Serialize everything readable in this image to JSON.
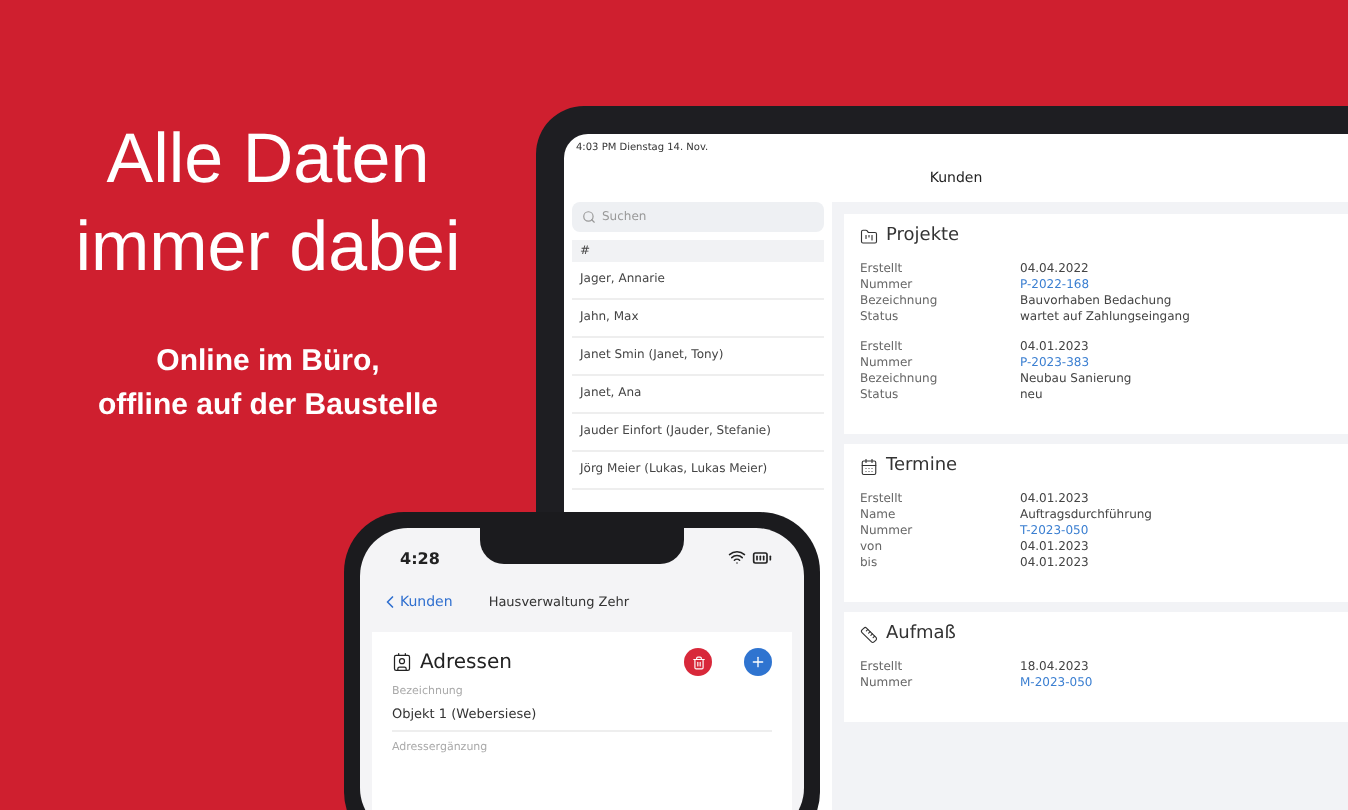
{
  "headline": [
    "Alle Daten",
    "immer dabei"
  ],
  "subline": [
    "Online im Büro,",
    "offline auf der Baustelle"
  ],
  "tablet": {
    "status": "4:03 PM  Dienstag 14. Nov.",
    "title": "Kunden",
    "search": {
      "placeholder": "Suchen"
    },
    "index_letter": "#",
    "customers": [
      {
        "name": "Jager, Annarie"
      },
      {
        "name": "Jahn, Max"
      },
      {
        "name": "Janet Smin (Janet, Tony)"
      },
      {
        "name": "Janet, Ana"
      },
      {
        "name": "Jauder Einfort (Jauder, Stefanie)"
      },
      {
        "name": "Jörg Meier (Lukas, Lukas Meier)"
      }
    ],
    "sections": [
      {
        "kind": "projects",
        "title": "Projekte",
        "groups": [
          [
            {
              "label": "Erstellt",
              "value": "04.04.2022",
              "link": false
            },
            {
              "label": "Nummer",
              "value": "P-2022-168",
              "link": true
            },
            {
              "label": "Bezeichnung",
              "value": "Bauvorhaben Bedachung",
              "link": false
            },
            {
              "label": "Status",
              "value": "wartet auf Zahlungseingang",
              "link": false
            }
          ],
          [
            {
              "label": "Erstellt",
              "value": "04.01.2023",
              "link": false
            },
            {
              "label": "Nummer",
              "value": "P-2023-383",
              "link": true
            },
            {
              "label": "Bezeichnung",
              "value": "Neubau Sanierung",
              "link": false
            },
            {
              "label": "Status",
              "value": "neu",
              "link": false
            }
          ]
        ]
      },
      {
        "kind": "appointments",
        "title": "Termine",
        "groups": [
          [
            {
              "label": "Erstellt",
              "value": "04.01.2023",
              "link": false
            },
            {
              "label": "Name",
              "value": "Auftragsdurchführung",
              "link": false
            },
            {
              "label": "Nummer",
              "value": "T-2023-050",
              "link": true
            },
            {
              "label": "von",
              "value": "04.01.2023",
              "link": false
            },
            {
              "label": "bis",
              "value": "04.01.2023",
              "link": false
            }
          ]
        ]
      },
      {
        "kind": "measurements",
        "title": "Aufmaß",
        "groups": [
          [
            {
              "label": "Erstellt",
              "value": "18.04.2023",
              "link": false
            },
            {
              "label": "Nummer",
              "value": "M-2023-050",
              "link": true
            }
          ]
        ]
      }
    ]
  },
  "phone": {
    "time": "4:28",
    "back": "Kunden",
    "title": "Hausverwaltung Zehr",
    "card_title": "Adressen",
    "fields": [
      {
        "label": "Bezeichnung",
        "value": "Objekt 1 (Webersiese)"
      },
      {
        "label": "Adressergänzung"
      }
    ]
  }
}
